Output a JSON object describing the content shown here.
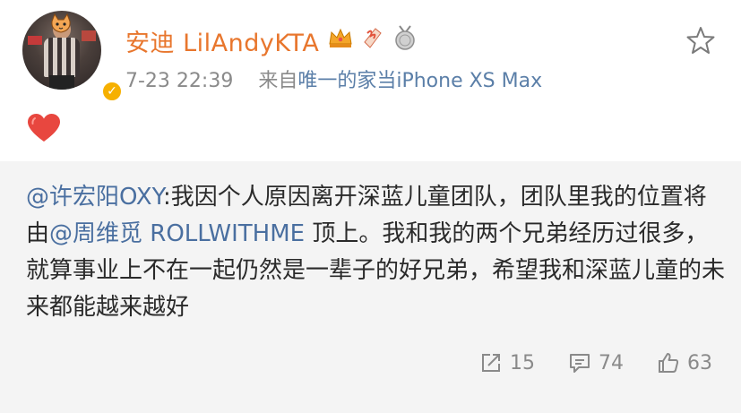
{
  "post": {
    "author": "安迪 LilAndyKTA",
    "timestamp": "7-23 22:39",
    "source_prefix": "来自",
    "source": "唯一的家当iPhone XS Max",
    "reaction_emoji": "heart-icon"
  },
  "repost": {
    "mention1": "@许宏阳OXY",
    "text1": ":我因个人原因离开深蓝儿童团队，团队里我的位置将由",
    "mention2": "@周维觅 ROLLWITHME",
    "text2": " 顶上。我和我的两个兄弟经历过很多，就算事业上不在一起仍然是一辈子的好兄弟，希望我和深蓝儿童的未来都能越来越好"
  },
  "actions": {
    "repost_count": "15",
    "comment_count": "74",
    "like_count": "63"
  },
  "colors": {
    "username": "#e8762d",
    "mention": "#4a6fa0",
    "meta": "#8a8a8a",
    "repost_bg": "#f4f4f4",
    "verified": "#f6b000"
  }
}
